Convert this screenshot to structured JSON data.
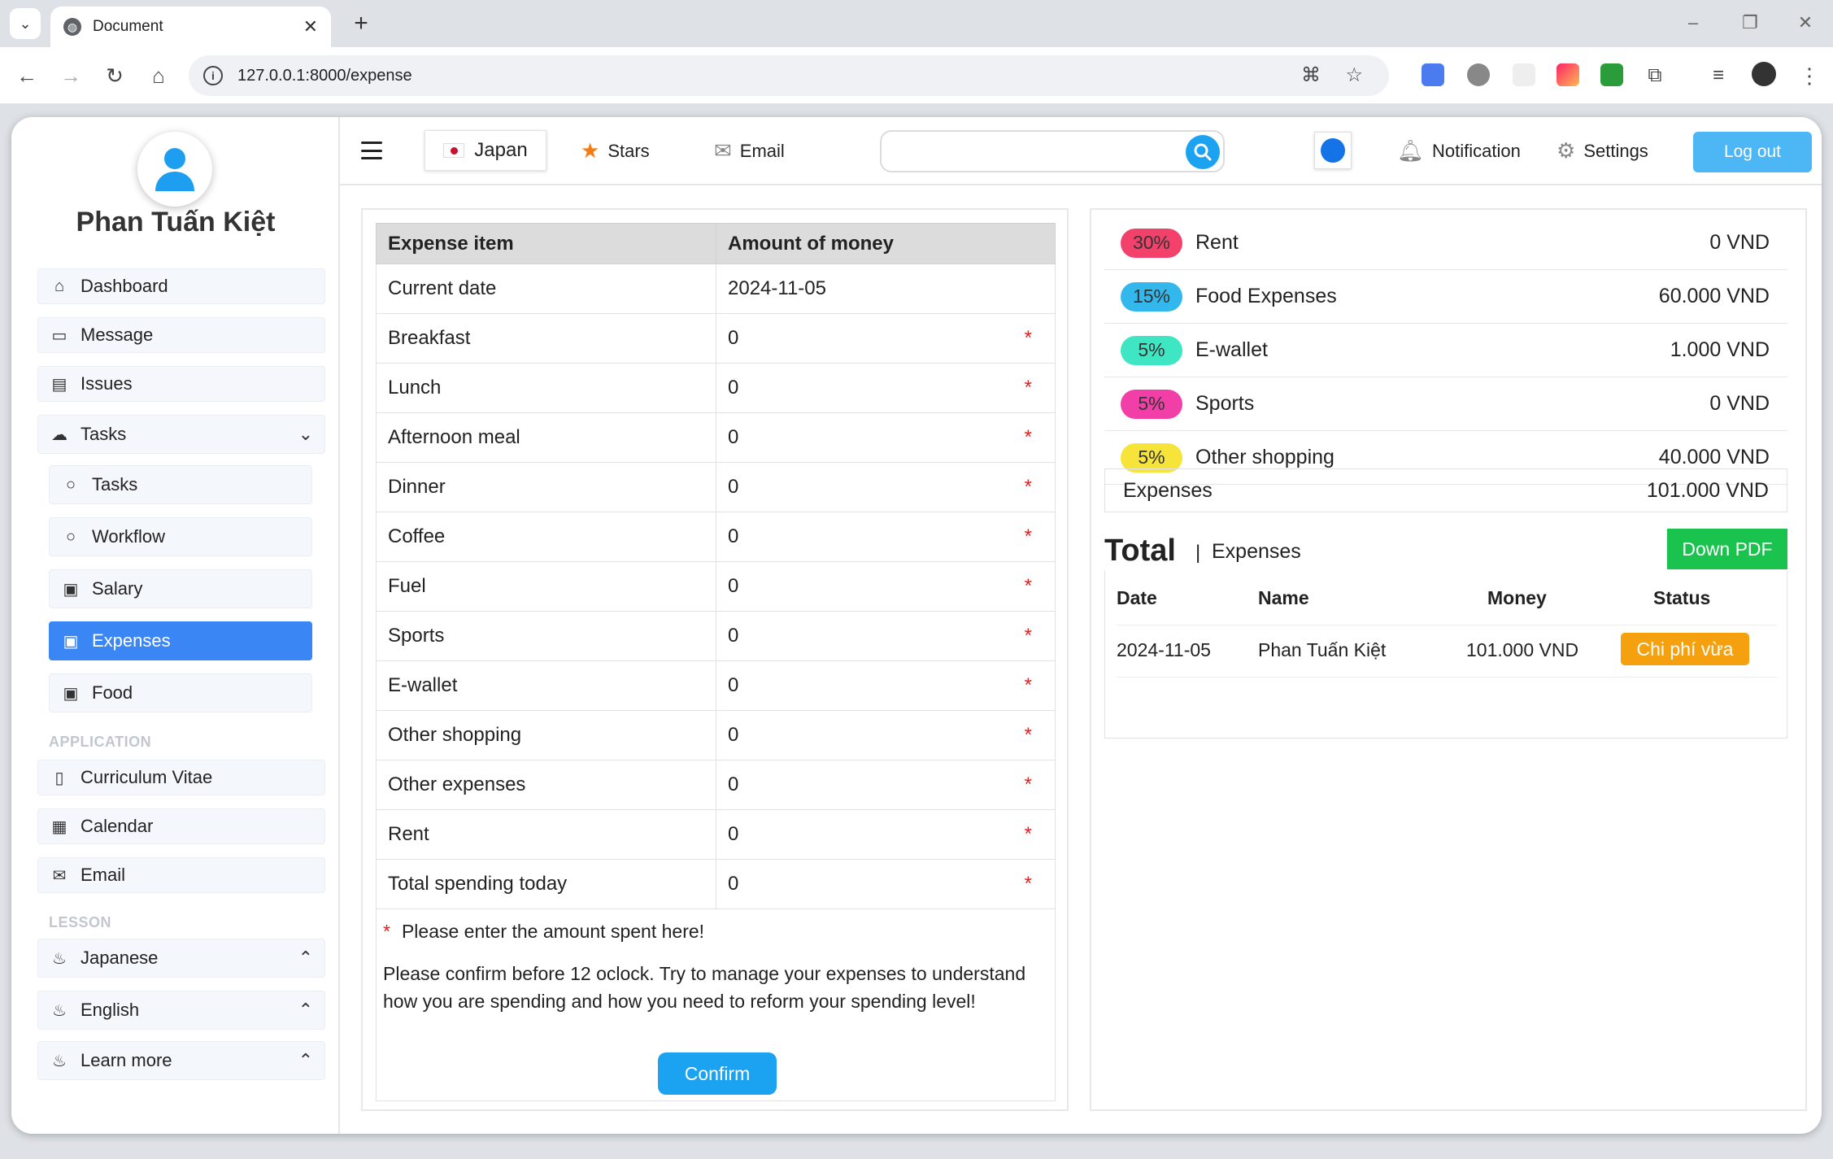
{
  "browser": {
    "tab_title": "Document",
    "url": "127.0.0.1:8000/expense"
  },
  "sidebar": {
    "username": "Phan Tuấn Kiệt",
    "items": [
      {
        "label": "Dashboard",
        "icon": "home-icon"
      },
      {
        "label": "Message",
        "icon": "message-icon"
      },
      {
        "label": "Issues",
        "icon": "inbox-icon"
      },
      {
        "label": "Tasks",
        "icon": "cloud-icon"
      },
      {
        "label": "Tasks",
        "icon": "circle-icon"
      },
      {
        "label": "Workflow",
        "icon": "circle-icon"
      },
      {
        "label": "Salary",
        "icon": "money-icon"
      },
      {
        "label": "Expenses",
        "icon": "money-icon"
      },
      {
        "label": "Food",
        "icon": "money-icon"
      }
    ],
    "application_heading": "APPLICATION",
    "application_items": [
      {
        "label": "Curriculum Vitae",
        "icon": "file-icon"
      },
      {
        "label": "Calendar",
        "icon": "calendar-icon"
      },
      {
        "label": "Email",
        "icon": "mail-icon"
      }
    ],
    "lesson_heading": "LESSON",
    "lesson_items": [
      {
        "label": "Japanese",
        "icon": "fire-icon"
      },
      {
        "label": "English",
        "icon": "fire-icon"
      },
      {
        "label": "Learn more",
        "icon": "fire-icon"
      }
    ]
  },
  "header": {
    "language": "Japan",
    "stars": "Stars",
    "email": "Email",
    "search_value": "",
    "notification": "Notification",
    "settings": "Settings",
    "logout": "Log out"
  },
  "expense_form": {
    "col_item": "Expense item",
    "col_amount": "Amount of money",
    "rows": [
      {
        "item": "Current date",
        "amount": "2024-11-05",
        "required": false
      },
      {
        "item": "Breakfast",
        "amount": "0",
        "required": true
      },
      {
        "item": "Lunch",
        "amount": "0",
        "required": true
      },
      {
        "item": "Afternoon meal",
        "amount": "0",
        "required": true
      },
      {
        "item": "Dinner",
        "amount": "0",
        "required": true
      },
      {
        "item": "Coffee",
        "amount": "0",
        "required": true
      },
      {
        "item": "Fuel",
        "amount": "0",
        "required": true
      },
      {
        "item": "Sports",
        "amount": "0",
        "required": true
      },
      {
        "item": "E-wallet",
        "amount": "0",
        "required": true
      },
      {
        "item": "Other shopping",
        "amount": "0",
        "required": true
      },
      {
        "item": "Other expenses",
        "amount": "0",
        "required": true
      },
      {
        "item": "Rent",
        "amount": "0",
        "required": true
      },
      {
        "item": "Total spending today",
        "amount": "0",
        "required": true
      }
    ],
    "required_marker": "*",
    "note": "Please enter the amount spent here!",
    "instructions": "Please confirm before 12 oclock. Try to manage your expenses to understand how you are spending and how you need to reform your spending level!",
    "confirm": "Confirm"
  },
  "summary": {
    "categories": [
      {
        "pct": "30%",
        "name": "Rent",
        "value": "0 VND",
        "color": "#f2416b"
      },
      {
        "pct": "15%",
        "name": "Food Expenses",
        "value": "60.000 VND",
        "color": "#33b8ee"
      },
      {
        "pct": "5%",
        "name": "E-wallet",
        "value": "1.000 VND",
        "color": "#3fe6c4"
      },
      {
        "pct": "5%",
        "name": "Sports",
        "value": "0 VND",
        "color": "#f23fa8"
      },
      {
        "pct": "5%",
        "name": "Other shopping",
        "value": "40.000 VND",
        "color": "#f7e43a"
      }
    ],
    "expenses_label": "Expenses",
    "expenses_value": "101.000 VND",
    "total_title": "Total",
    "total_separator": "|",
    "total_subtitle": "Expenses",
    "pdf_button": "Down PDF",
    "history_headers": [
      "Date",
      "Name",
      "Money",
      "Status"
    ],
    "history_rows": [
      {
        "date": "2024-11-05",
        "name": "Phan Tuấn Kiệt",
        "money": "101.000 VND",
        "status": "Chi phí vừa"
      }
    ]
  }
}
